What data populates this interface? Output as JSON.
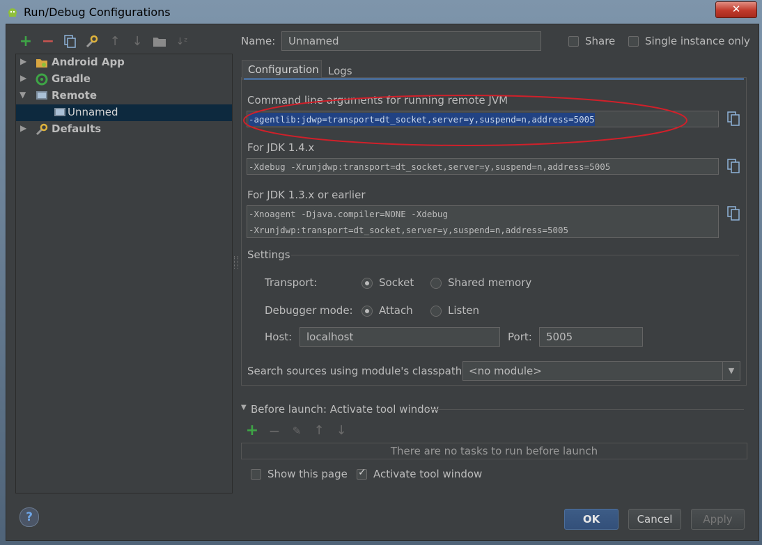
{
  "window": {
    "title": "Run/Debug Configurations",
    "close_label": "✕"
  },
  "toolbar": {
    "icons": [
      "add-icon",
      "remove-icon",
      "copy-icon",
      "edit-defaults-icon",
      "move-up-icon",
      "move-down-icon",
      "folder-icon",
      "sort-icon"
    ]
  },
  "tree": {
    "items": [
      {
        "label": "Android App",
        "expanded": false
      },
      {
        "label": "Gradle",
        "expanded": false
      },
      {
        "label": "Remote",
        "expanded": true
      },
      {
        "label": "Unnamed",
        "selected": true
      },
      {
        "label": "Defaults",
        "expanded": false
      }
    ]
  },
  "form": {
    "name_label": "Name:",
    "name_value": "Unnamed",
    "share_label": "Share",
    "single_instance_label": "Single instance only",
    "tabs": [
      "Configuration",
      "Logs"
    ],
    "cmd_label": "Command line arguments for running remote JVM",
    "cmd_value": "-agentlib:jdwp=transport=dt_socket,server=y,suspend=n,address=5005",
    "jdk14_label": "For JDK 1.4.x",
    "jdk14_value": "-Xdebug -Xrunjdwp:transport=dt_socket,server=y,suspend=n,address=5005",
    "jdk13_label": "For JDK 1.3.x or earlier",
    "jdk13_line1": "-Xnoagent -Djava.compiler=NONE -Xdebug",
    "jdk13_line2": "-Xrunjdwp:transport=dt_socket,server=y,suspend=n,address=5005",
    "settings_label": "Settings",
    "transport_label": "Transport:",
    "transport_options": [
      "Socket",
      "Shared memory"
    ],
    "transport_selected": "Socket",
    "debugger_label": "Debugger mode:",
    "debugger_options": [
      "Attach",
      "Listen"
    ],
    "debugger_selected": "Attach",
    "host_label": "Host:",
    "host_value": "localhost",
    "port_label": "Port:",
    "port_value": "5005",
    "search_sources_label": "Search sources using module's classpath:",
    "module_value": "<no module>"
  },
  "before_launch": {
    "title": "Before launch: Activate tool window",
    "empty_text": "There are no tasks to run before launch",
    "show_page_label": "Show this page",
    "show_page_checked": false,
    "activate_label": "Activate tool window",
    "activate_checked": true
  },
  "buttons": {
    "ok": "OK",
    "cancel": "Cancel",
    "apply": "Apply",
    "help": "?"
  },
  "colors": {
    "background": "#3c3f41",
    "selection": "#0d293e",
    "text_selection": "#214283",
    "accent_green": "#3ea546",
    "annotation_red": "#d0202a"
  }
}
